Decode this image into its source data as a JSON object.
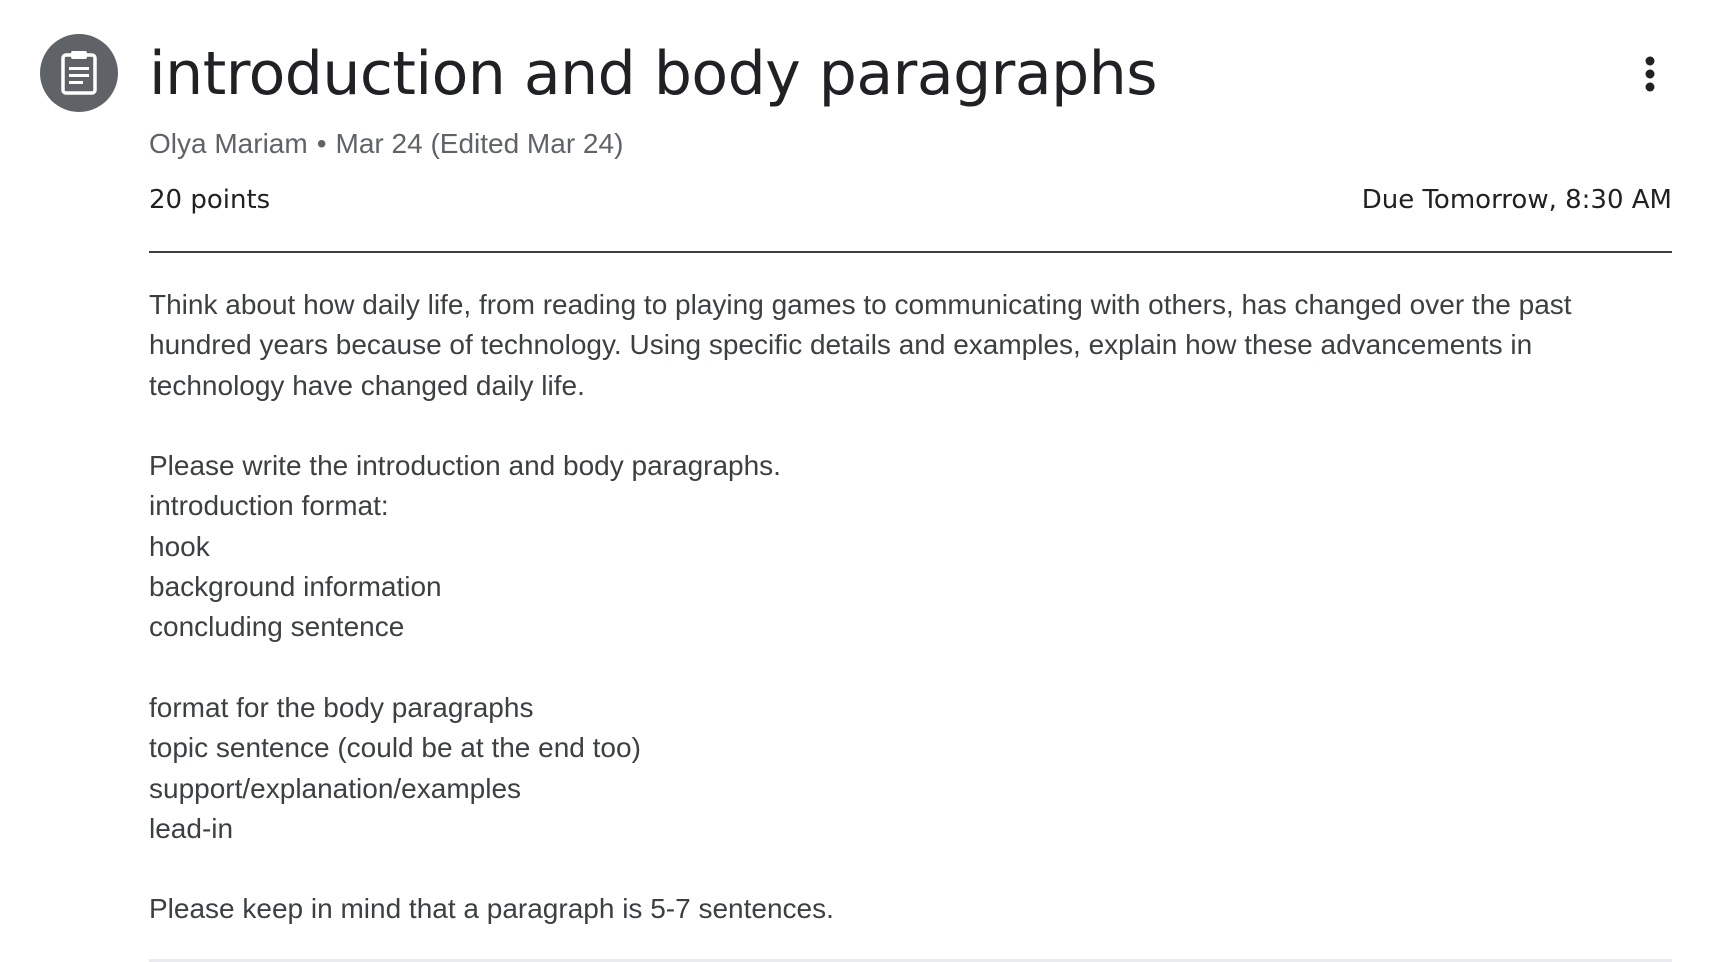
{
  "assignment": {
    "icon": "assignment-icon",
    "title": "introduction and body paragraphs",
    "author": "Olya Mariam",
    "separator": "•",
    "date": "Mar 24 (Edited Mar 24)",
    "points": "20 points",
    "due": "Due Tomorrow, 8:30 AM",
    "more_icon": "more-vert-icon"
  },
  "instructions": {
    "prompt": "Think about how daily life, from reading to playing games to communicating with others, has changed over the past hundred years because of technology. Using specific details and examples, explain how these advancements in technology have changed daily life.",
    "lines": [
      "",
      "Please write the introduction and body paragraphs.",
      "introduction format:",
      "hook",
      "background information",
      "concluding sentence",
      "",
      "format for the body paragraphs",
      "topic sentence (could be at the end too)",
      "support/explanation/examples",
      "lead-in",
      "",
      "Please keep in mind that a paragraph is 5-7 sentences."
    ]
  },
  "colors": {
    "icon_bg": "#5f6368",
    "title_text": "#202124",
    "meta_text": "#5f6368",
    "body_text": "#3c4043",
    "divider": "#3c4043"
  }
}
